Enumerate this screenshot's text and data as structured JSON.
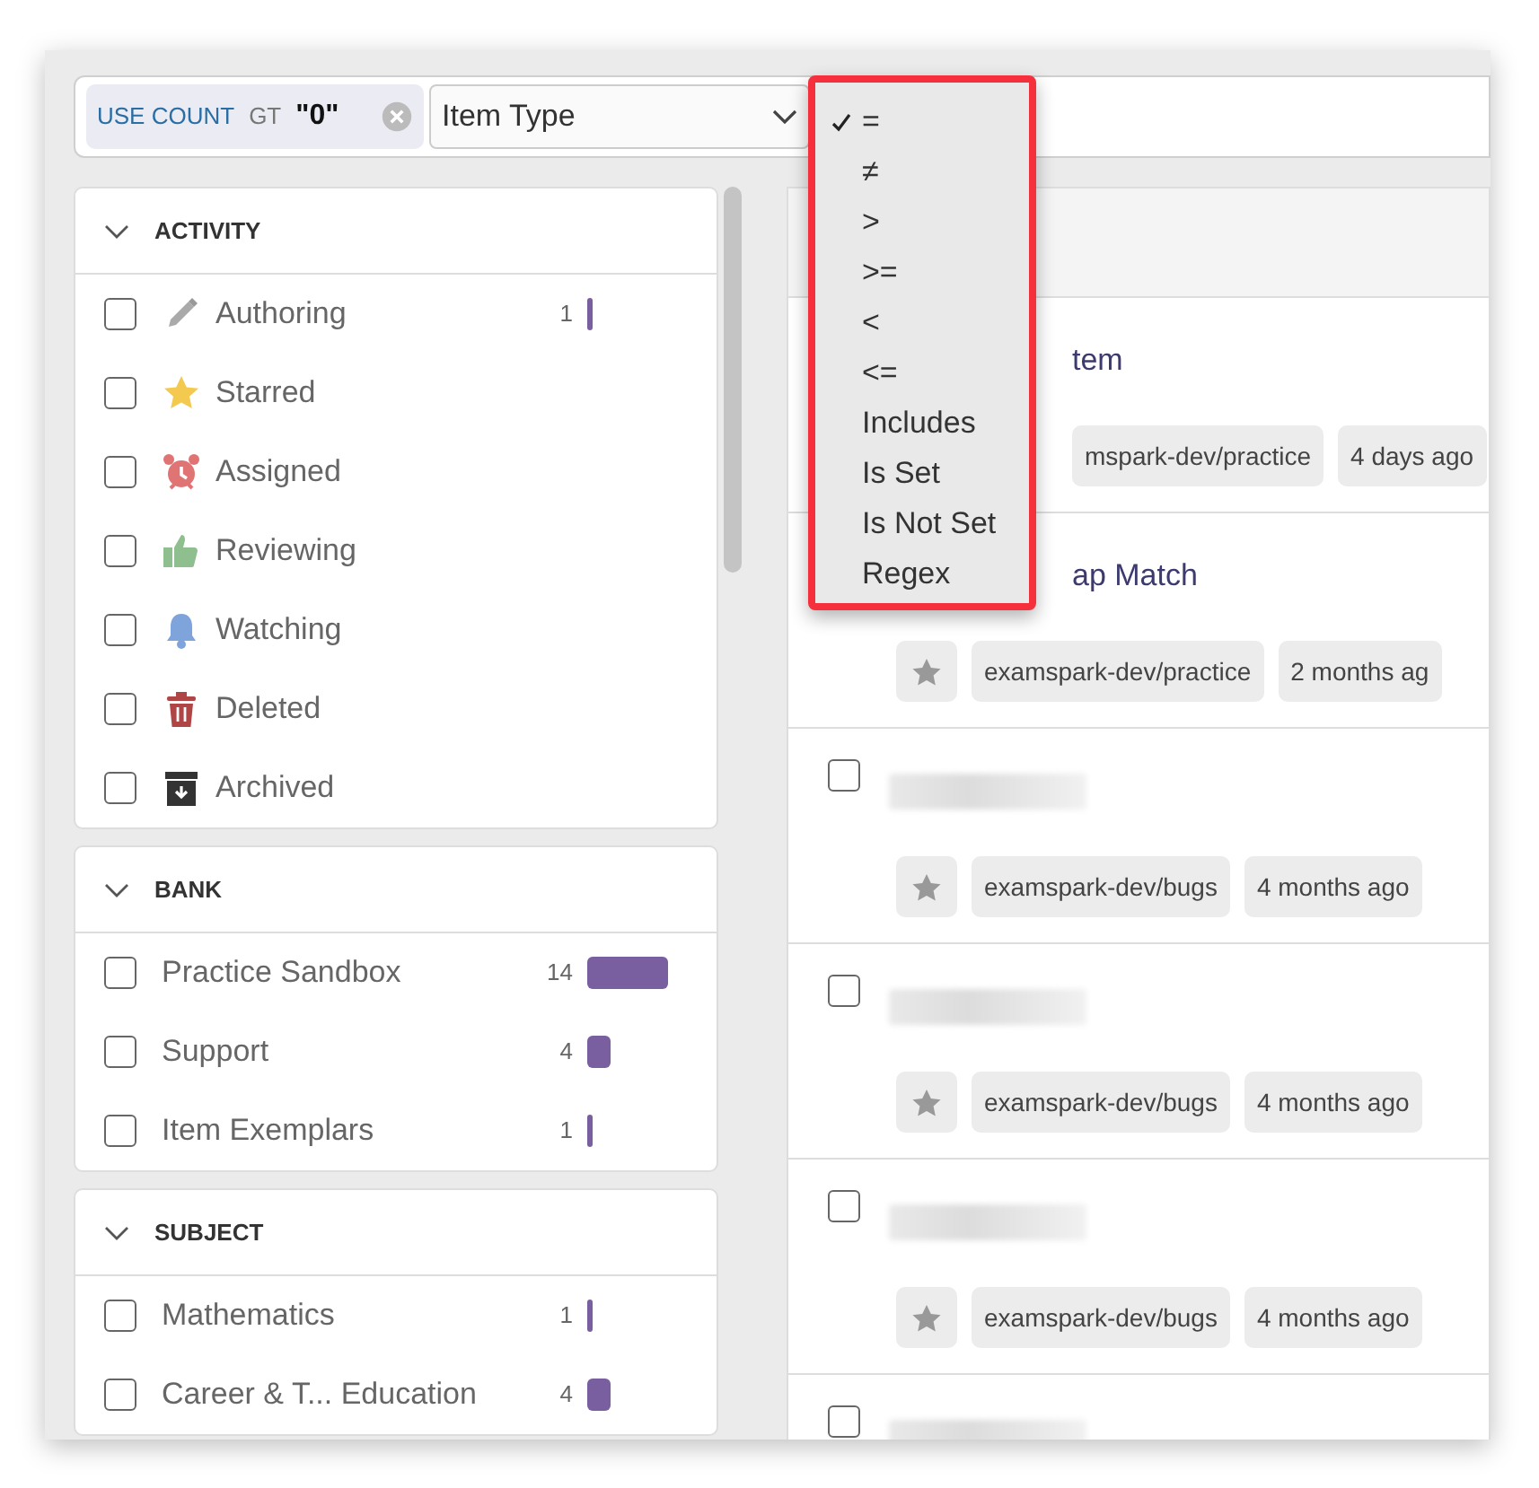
{
  "filter_bar": {
    "chip": {
      "field": "USE COUNT",
      "operator": "GT",
      "value": "\"0\""
    },
    "select": {
      "value": "Item Type"
    }
  },
  "operator_menu": [
    {
      "label": "=",
      "selected": true
    },
    {
      "label": "≠",
      "selected": false
    },
    {
      "label": ">",
      "selected": false
    },
    {
      "label": ">=",
      "selected": false
    },
    {
      "label": "<",
      "selected": false
    },
    {
      "label": "<=",
      "selected": false
    },
    {
      "label": "Includes",
      "selected": false
    },
    {
      "label": "Is Set",
      "selected": false
    },
    {
      "label": "Is Not Set",
      "selected": false
    },
    {
      "label": "Regex",
      "selected": false
    }
  ],
  "sidebar": [
    {
      "title": "ACTIVITY",
      "expanded": true,
      "kind": "activity",
      "items": [
        {
          "label": "Authoring",
          "checked": false,
          "count": "1"
        },
        {
          "label": "Starred",
          "checked": false
        },
        {
          "label": "Assigned",
          "checked": false
        },
        {
          "label": "Reviewing",
          "checked": false
        },
        {
          "label": "Watching",
          "checked": false
        },
        {
          "label": "Deleted",
          "checked": false
        },
        {
          "label": "Archived",
          "checked": false
        }
      ]
    },
    {
      "title": "BANK",
      "expanded": true,
      "kind": "plain",
      "items": [
        {
          "label": "Practice Sandbox",
          "checked": false,
          "count": "14"
        },
        {
          "label": "Support",
          "checked": false,
          "count": "4"
        },
        {
          "label": "Item Exemplars",
          "checked": false,
          "count": "1"
        }
      ]
    },
    {
      "title": "SUBJECT",
      "expanded": true,
      "kind": "plain",
      "items": [
        {
          "label": "Mathematics",
          "checked": false,
          "count": "1"
        },
        {
          "label": "Career & T... Education",
          "checked": false,
          "count": "4"
        }
      ]
    }
  ],
  "items": [
    {
      "kind": "covered-top",
      "title": "tem",
      "tags": [
        {
          "kind": "repo",
          "label": "mspark-dev/practice"
        },
        {
          "kind": "date",
          "label": "4 days ago"
        }
      ]
    },
    {
      "kind": "covered-title",
      "title": "ap Match",
      "tags": [
        {
          "kind": "star"
        },
        {
          "kind": "repo",
          "label": "examspark-dev/practice"
        },
        {
          "kind": "date",
          "label": "2 months ag"
        }
      ]
    },
    {
      "kind": "blurred",
      "checked": false,
      "tags": [
        {
          "kind": "star"
        },
        {
          "kind": "repo",
          "label": "examspark-dev/bugs"
        },
        {
          "kind": "date",
          "label": "4 months ago"
        }
      ]
    },
    {
      "kind": "blurred",
      "checked": false,
      "tags": [
        {
          "kind": "star"
        },
        {
          "kind": "repo",
          "label": "examspark-dev/bugs"
        },
        {
          "kind": "date",
          "label": "4 months ago"
        }
      ]
    },
    {
      "kind": "blurred",
      "checked": false,
      "tags": [
        {
          "kind": "star"
        },
        {
          "kind": "repo",
          "label": "examspark-dev/bugs"
        },
        {
          "kind": "date",
          "label": "4 months ago"
        }
      ]
    },
    {
      "kind": "blurred",
      "checked": false
    }
  ]
}
